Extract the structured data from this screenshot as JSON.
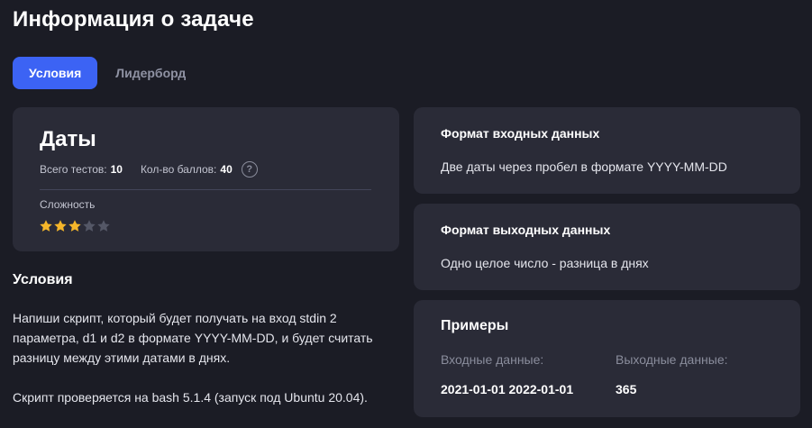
{
  "header": {
    "title": "Информация о задаче"
  },
  "tabs": [
    {
      "label": "Условия",
      "active": true
    },
    {
      "label": "Лидерборд",
      "active": false
    }
  ],
  "task": {
    "name": "Даты",
    "tests_label": "Всего тестов:",
    "tests_value": "10",
    "points_label": "Кол-во баллов:",
    "points_value": "40",
    "help_glyph": "?",
    "difficulty_label": "Сложность",
    "difficulty_rating": 3,
    "difficulty_max": 5
  },
  "conditions": {
    "title": "Условия",
    "paragraph1": "Напиши скрипт, который будет получать на вход stdin 2 параметра, d1 и d2 в формате YYYY-MM-DD, и будет считать разницу между этими датами в днях.",
    "paragraph2": "Скрипт проверяется на bash 5.1.4 (запуск под Ubuntu 20.04)."
  },
  "input_format": {
    "title": "Формат входных данных",
    "text": "Две даты через пробел в формате YYYY-MM-DD"
  },
  "output_format": {
    "title": "Формат выходных данных",
    "text": "Одно целое число - разница в днях"
  },
  "examples": {
    "title": "Примеры",
    "input_label": "Входные данные:",
    "output_label": "Выходные данные:",
    "input_value": "2021-01-01 2022-01-01",
    "output_value": "365"
  },
  "colors": {
    "background": "#1b1c25",
    "card": "#2a2b37",
    "accent": "#3c63f4",
    "star_filled": "#f5b62a",
    "star_empty": "#545766"
  }
}
